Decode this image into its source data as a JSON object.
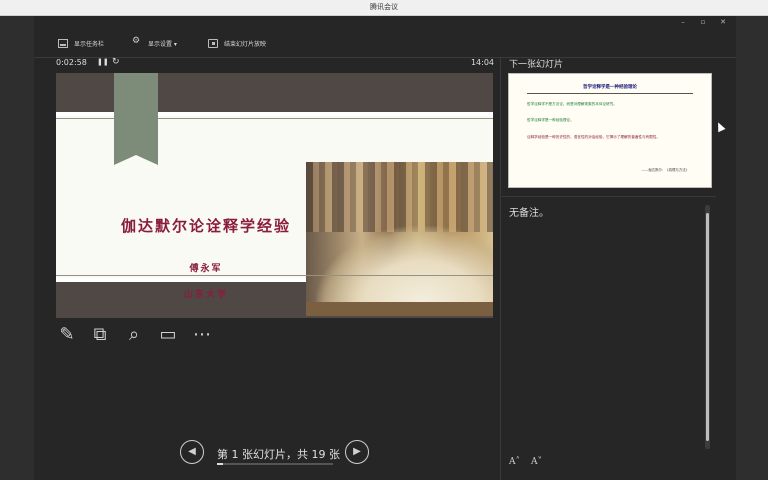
{
  "app": {
    "title": "腾讯会议"
  },
  "window_controls": {
    "minimize": "–",
    "restore": "▫",
    "close": "✕"
  },
  "toolbar": {
    "show_taskbar": "显示任务栏",
    "display_settings": "显示设置 ▾",
    "end_slideshow": "结束幻灯片放映"
  },
  "timer": {
    "elapsed": "0:02:58",
    "pause_glyph": "❚❚",
    "reset_glyph": "↻",
    "clock": "14:04"
  },
  "current_slide": {
    "title": "伽达默尔论诠释学经验",
    "author": "傅永军",
    "university": "山东大学"
  },
  "slide_tools": {
    "pen": "✎",
    "slides": "⧉",
    "zoom": "⌕",
    "screen": "▭",
    "more": "⋯"
  },
  "navigation": {
    "prev_glyph": "◀",
    "next_glyph": "▶",
    "label": "第 1 张幻灯片，共 19 张",
    "progress": 0.0526
  },
  "next_slide": {
    "header": "下一张幻灯片",
    "title": "哲学诠释学是一种经验理论",
    "lines": [
      {
        "text": "哲学诠释学不是方法论，而是对理解现象的本体论研究。",
        "color": "#1f7a3a"
      },
      {
        "text": "哲学诠释学是一种经验理论。",
        "color": "#1f7a3a"
      },
      {
        "text": "诠释学经验是一种历史性的、语言性的对话经验，它揭示了理解的普遍性与有限性。",
        "color": "#8a1d3a"
      }
    ],
    "citation": "——伽达默尔：《真理与方法》"
  },
  "notes": {
    "text": "无备注。",
    "font_up": "A˄",
    "font_down": "A˅"
  }
}
